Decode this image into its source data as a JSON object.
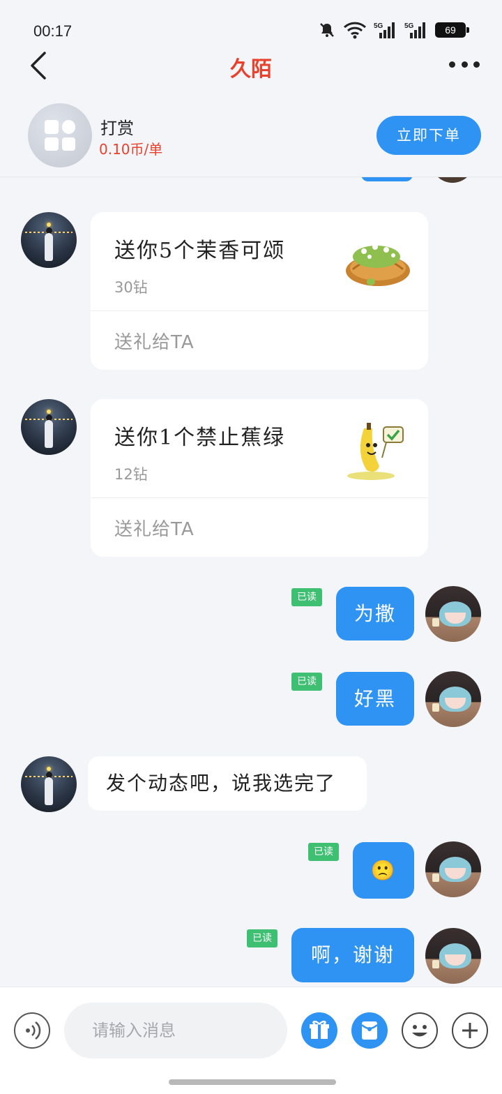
{
  "status": {
    "time": "00:17",
    "battery": "69"
  },
  "nav": {
    "title": "久陌"
  },
  "reward": {
    "title": "打赏",
    "price": "0.10币/单",
    "order_button": "立即下单"
  },
  "messages": [
    {
      "type": "gift",
      "side": "left",
      "title": "送你5个茉香可颂",
      "price": "30钻",
      "action": "送礼给TA",
      "icon": "croissant-gift-icon"
    },
    {
      "type": "gift",
      "side": "left",
      "title": "送你1个禁止蕉绿",
      "price": "12钻",
      "action": "送礼给TA",
      "icon": "banana-gift-icon"
    },
    {
      "type": "text",
      "side": "right",
      "text": "为撒",
      "read": "已读"
    },
    {
      "type": "text",
      "side": "right",
      "text": "好黑",
      "read": "已读"
    },
    {
      "type": "text",
      "side": "left",
      "text": "发个动态吧，说我选完了"
    },
    {
      "type": "emoji",
      "side": "right",
      "text": "🙁",
      "read": "已读"
    },
    {
      "type": "text",
      "side": "right",
      "text": "啊，谢谢",
      "read": "已读"
    }
  ],
  "input": {
    "placeholder": "请输入消息"
  },
  "colors": {
    "accent_blue": "#2e93f3",
    "title_red": "#e8412c",
    "read_green": "#3fbf72",
    "background": "#f3f5f8"
  }
}
